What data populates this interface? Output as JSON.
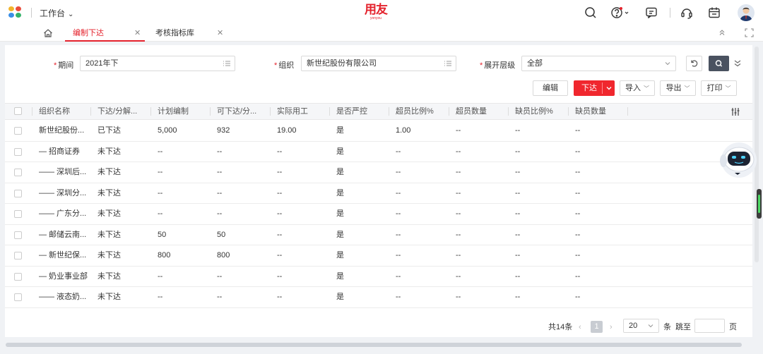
{
  "topbar": {
    "workbench_label": "工作台",
    "brand_main": "用友",
    "brand_sub": "yonyou",
    "icons": [
      "search-icon",
      "help-icon",
      "message-icon",
      "headset-icon",
      "calendar-icon"
    ]
  },
  "tabs": [
    {
      "label": "编制下达",
      "active": true
    },
    {
      "label": "考核指标库",
      "active": false
    }
  ],
  "filters": {
    "period_label": "期间",
    "period_value": "2021年下",
    "org_label": "组织",
    "org_value": "新世纪股份有限公司",
    "level_label": "展开层级",
    "level_value": "全部"
  },
  "toolbar": {
    "edit_label": "编辑",
    "issue_label": "下达",
    "import_label": "导入",
    "export_label": "导出",
    "print_label": "打印"
  },
  "table": {
    "columns": [
      "组织名称",
      "下达/分解...",
      "计划编制",
      "可下达/分...",
      "实际用工",
      "是否严控",
      "超员比例%",
      "超员数量",
      "缺员比例%",
      "缺员数量"
    ],
    "rows": [
      [
        "新世纪股份...",
        "已下达",
        "5,000",
        "932",
        "19.00",
        "是",
        "1.00",
        "--",
        "--",
        "--"
      ],
      [
        "— 招商证券",
        "未下达",
        "--",
        "--",
        "--",
        "是",
        "--",
        "--",
        "--",
        "--"
      ],
      [
        "—— 深圳后...",
        "未下达",
        "--",
        "--",
        "--",
        "是",
        "--",
        "--",
        "--",
        "--"
      ],
      [
        "—— 深圳分...",
        "未下达",
        "--",
        "--",
        "--",
        "是",
        "--",
        "--",
        "--",
        "--"
      ],
      [
        "—— 广东分...",
        "未下达",
        "--",
        "--",
        "--",
        "是",
        "--",
        "--",
        "--",
        "--"
      ],
      [
        "— 邮储云南...",
        "未下达",
        "50",
        "50",
        "--",
        "是",
        "--",
        "--",
        "--",
        "--"
      ],
      [
        "— 新世纪保...",
        "未下达",
        "800",
        "800",
        "--",
        "是",
        "--",
        "--",
        "--",
        "--"
      ],
      [
        "— 奶业事业部",
        "未下达",
        "--",
        "--",
        "--",
        "是",
        "--",
        "--",
        "--",
        "--"
      ],
      [
        "—— 液态奶...",
        "未下达",
        "--",
        "--",
        "--",
        "是",
        "--",
        "--",
        "--",
        "--"
      ]
    ]
  },
  "pagination": {
    "total_label": "共14条",
    "current_page": "1",
    "page_size": "20",
    "size_unit": "条",
    "jump_label": "跳至",
    "page_unit": "页"
  },
  "colors": {
    "accent": "#f0272e",
    "brand": "#e4222c"
  }
}
